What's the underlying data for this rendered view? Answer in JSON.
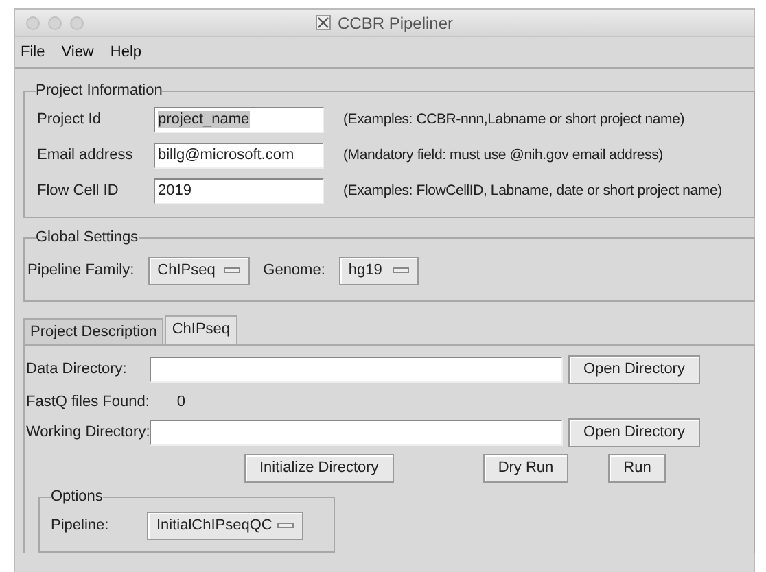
{
  "window": {
    "title": "CCBR Pipeliner"
  },
  "menu": [
    "File",
    "View",
    "Help"
  ],
  "project_information": {
    "title": "Project Information",
    "rows": [
      {
        "label": "Project Id",
        "value": "project_name",
        "highlighted": true,
        "hint": "(Examples: CCBR-nnn,Labname or short project name)"
      },
      {
        "label": "Email address",
        "value": "billg@microsoft.com",
        "highlighted": false,
        "hint": "(Mandatory field: must use @nih.gov email address)"
      },
      {
        "label": "Flow Cell ID",
        "value": "2019",
        "highlighted": false,
        "hint": "(Examples: FlowCellID, Labname, date or short project name)"
      }
    ]
  },
  "global_settings": {
    "title": "Global Settings",
    "pipeline_family": {
      "label": "Pipeline Family:",
      "value": "ChIPseq"
    },
    "genome": {
      "label": "Genome:",
      "value": "hg19"
    }
  },
  "tabs": [
    {
      "label": "Project Description",
      "selected": false
    },
    {
      "label": "ChIPseq",
      "selected": true
    }
  ],
  "data_directory": {
    "label": "Data Directory:",
    "button": "Open Directory"
  },
  "fastq": {
    "label": "FastQ files Found:",
    "value": "0"
  },
  "working_directory": {
    "label": "Working Directory:",
    "button": "Open Directory"
  },
  "actions": [
    "Initialize Directory",
    "Dry Run",
    "Run"
  ],
  "options": {
    "title": "Options",
    "pipeline": {
      "label": "Pipeline:",
      "value": "InitialChIPseqQC"
    }
  }
}
